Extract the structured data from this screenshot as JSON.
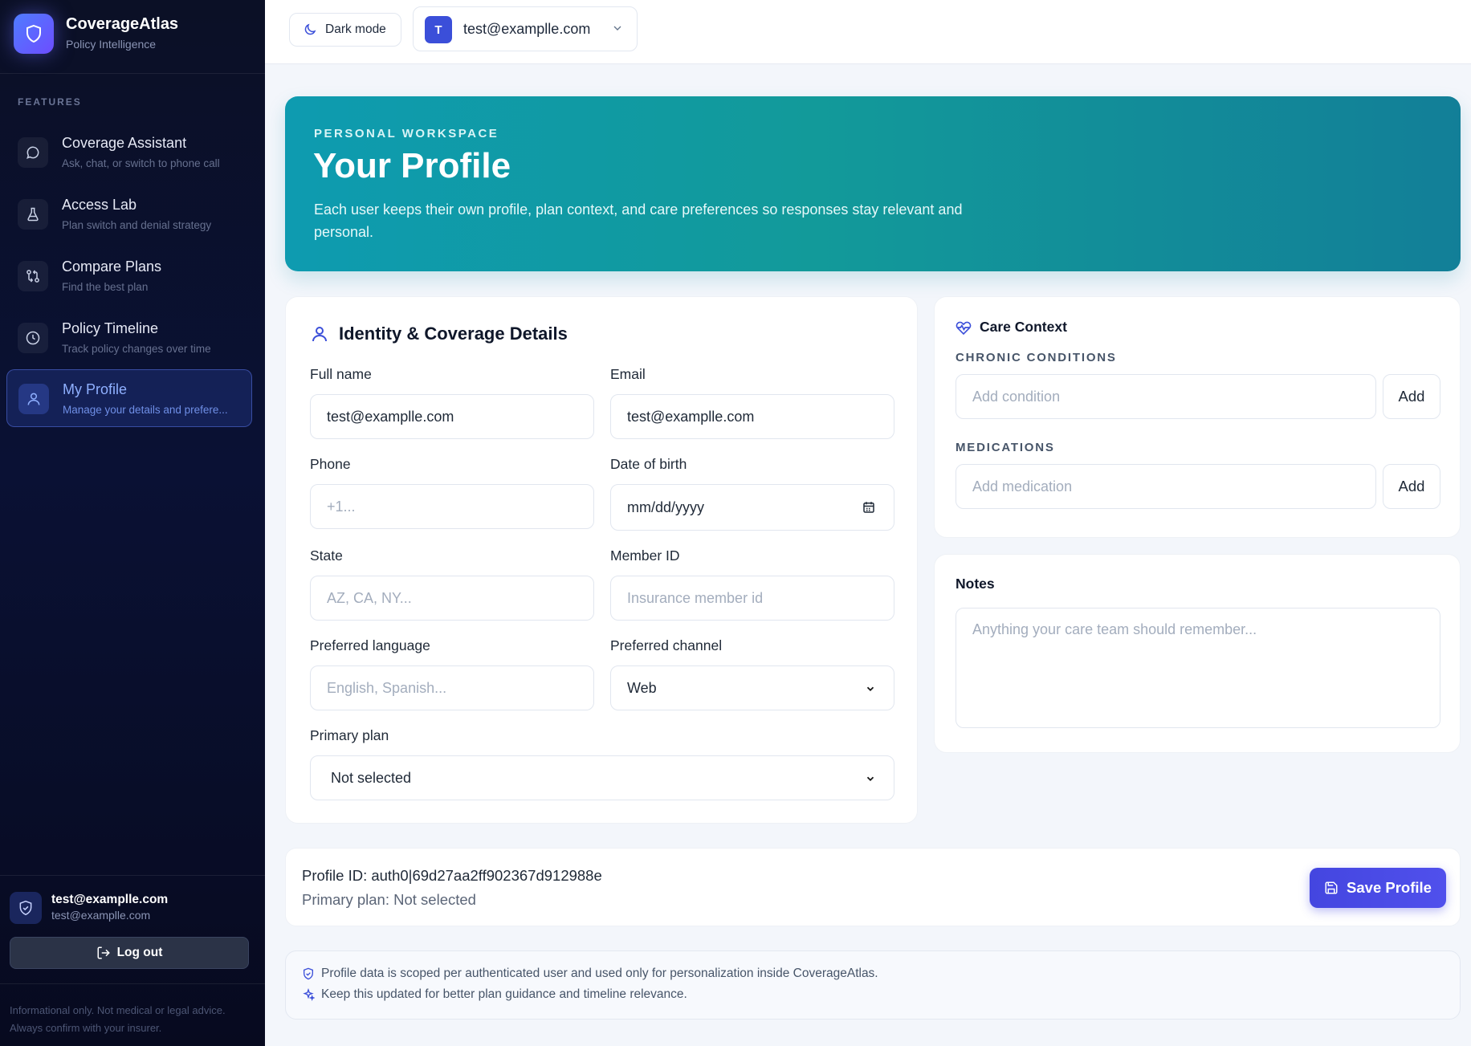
{
  "brand": {
    "name": "CoverageAtlas",
    "tagline": "Policy Intelligence"
  },
  "sidebar": {
    "section_label": "FEATURES",
    "items": [
      {
        "title": "Coverage Assistant",
        "subtitle": "Ask, chat, or switch to phone call",
        "icon": "chat-bubble-icon"
      },
      {
        "title": "Access Lab",
        "subtitle": "Plan switch and denial strategy",
        "icon": "flask-icon"
      },
      {
        "title": "Compare Plans",
        "subtitle": "Find the best plan",
        "icon": "compare-arrows-icon"
      },
      {
        "title": "Policy Timeline",
        "subtitle": "Track policy changes over time",
        "icon": "clock-icon"
      },
      {
        "title": "My Profile",
        "subtitle": "Manage your details and prefere...",
        "icon": "user-icon",
        "active": true
      }
    ],
    "user": {
      "name": "test@examplle.com",
      "email": "test@examplle.com"
    },
    "logout_label": "Log out",
    "disclaimer": "Informational only. Not medical or legal advice. Always confirm with your insurer."
  },
  "topbar": {
    "dark_mode_label": "Dark mode",
    "account": {
      "initial": "T",
      "email": "test@examplle.com"
    }
  },
  "hero": {
    "kicker": "PERSONAL WORKSPACE",
    "title": "Your Profile",
    "description": "Each user keeps their own profile, plan context, and care preferences so responses stay relevant and personal."
  },
  "identity": {
    "title": "Identity & Coverage Details",
    "full_name": {
      "label": "Full name",
      "value": "test@examplle.com"
    },
    "email": {
      "label": "Email",
      "value": "test@examplle.com"
    },
    "phone": {
      "label": "Phone",
      "placeholder": "+1..."
    },
    "dob": {
      "label": "Date of birth",
      "placeholder": "mm/dd/yyyy"
    },
    "state": {
      "label": "State",
      "placeholder": "AZ, CA, NY..."
    },
    "member_id": {
      "label": "Member ID",
      "placeholder": "Insurance member id"
    },
    "language": {
      "label": "Preferred language",
      "placeholder": "English, Spanish..."
    },
    "channel": {
      "label": "Preferred channel",
      "value": "Web"
    },
    "primary_plan": {
      "label": "Primary plan",
      "value": "Not selected"
    }
  },
  "care": {
    "title": "Care Context",
    "conditions_label": "CHRONIC CONDITIONS",
    "conditions_placeholder": "Add condition",
    "medications_label": "MEDICATIONS",
    "medications_placeholder": "Add medication",
    "add_label": "Add"
  },
  "notes": {
    "title": "Notes",
    "placeholder": "Anything your care team should remember..."
  },
  "summary": {
    "profile_id": "Profile ID: auth0|69d27aa2ff902367d912988e",
    "primary_plan": "Primary plan: Not selected",
    "save_label": "Save Profile"
  },
  "info": {
    "line1": "Profile data is scoped per authenticated user and used only for personalization inside CoverageAtlas.",
    "line2": "Keep this updated for better plan guidance and timeline relevance."
  },
  "colors": {
    "accent": "#4446e0",
    "hero_teal": "#0e9bb0",
    "sidebar_bg": "#0b1026"
  }
}
